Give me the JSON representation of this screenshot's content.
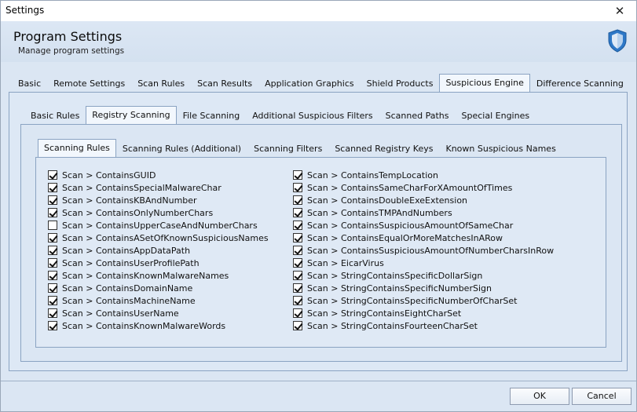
{
  "window": {
    "title": "Settings",
    "close_glyph": "✕"
  },
  "header": {
    "title": "Program Settings",
    "subtitle": "Manage program settings",
    "icon": "shield-icon"
  },
  "main_tabs": [
    {
      "label": "Basic",
      "active": false
    },
    {
      "label": "Remote Settings",
      "active": false
    },
    {
      "label": "Scan Rules",
      "active": false
    },
    {
      "label": "Scan Results",
      "active": false
    },
    {
      "label": "Application Graphics",
      "active": false
    },
    {
      "label": "Shield Products",
      "active": false
    },
    {
      "label": "Suspicious Engine",
      "active": true
    },
    {
      "label": "Difference Scanning",
      "active": false
    }
  ],
  "sub_tabs": [
    {
      "label": "Basic Rules",
      "active": false
    },
    {
      "label": "Registry Scanning",
      "active": true
    },
    {
      "label": "File Scanning",
      "active": false
    },
    {
      "label": "Additional Suspicious Filters",
      "active": false
    },
    {
      "label": "Scanned Paths",
      "active": false
    },
    {
      "label": "Special Engines",
      "active": false
    }
  ],
  "inner_tabs": [
    {
      "label": "Scanning Rules",
      "active": true
    },
    {
      "label": "Scanning Rules (Additional)",
      "active": false
    },
    {
      "label": "Scanning Filters",
      "active": false
    },
    {
      "label": "Scanned Registry Keys",
      "active": false
    },
    {
      "label": "Known Suspicious Names",
      "active": false
    }
  ],
  "rules_left": [
    {
      "label": "Scan > ContainsGUID",
      "checked": true
    },
    {
      "label": "Scan > ContainsSpecialMalwareChar",
      "checked": true
    },
    {
      "label": "Scan > ContainsKBAndNumber",
      "checked": true
    },
    {
      "label": "Scan > ContainsOnlyNumberChars",
      "checked": true
    },
    {
      "label": "Scan > ContainsUpperCaseAndNumberChars",
      "checked": false
    },
    {
      "label": "Scan > ContainsASetOfKnownSuspiciousNames",
      "checked": true
    },
    {
      "label": "Scan > ContainsAppDataPath",
      "checked": true
    },
    {
      "label": "Scan > ContainsUserProfilePath",
      "checked": true
    },
    {
      "label": "Scan > ContainsKnownMalwareNames",
      "checked": true
    },
    {
      "label": "Scan > ContainsDomainName",
      "checked": true
    },
    {
      "label": "Scan > ContainsMachineName",
      "checked": true
    },
    {
      "label": "Scan > ContainsUserName",
      "checked": true
    },
    {
      "label": "Scan > ContainsKnownMalwareWords",
      "checked": true
    }
  ],
  "rules_right": [
    {
      "label": "Scan > ContainsTempLocation",
      "checked": true
    },
    {
      "label": "Scan > ContainsSameCharForXAmountOfTimes",
      "checked": true
    },
    {
      "label": "Scan > ContainsDoubleExeExtension",
      "checked": true
    },
    {
      "label": "Scan > ContainsTMPAndNumbers",
      "checked": true
    },
    {
      "label": "Scan > ContainsSuspiciousAmountOfSameChar",
      "checked": true
    },
    {
      "label": "Scan > ContainsEqualOrMoreMatchesInARow",
      "checked": true
    },
    {
      "label": "Scan > ContainsSuspiciousAmountOfNumberCharsInRow",
      "checked": true
    },
    {
      "label": "Scan > EicarVirus",
      "checked": true
    },
    {
      "label": "Scan > StringContainsSpecificDollarSign",
      "checked": true
    },
    {
      "label": "Scan > StringContainsSpecificNumberSign",
      "checked": true
    },
    {
      "label": "Scan > StringContainsSpecificNumberOfCharSet",
      "checked": true
    },
    {
      "label": "Scan > StringContainsEightCharSet",
      "checked": true
    },
    {
      "label": "Scan > StringContainsFourteenCharSet",
      "checked": true
    }
  ],
  "footer": {
    "ok_label": "OK",
    "cancel_label": "Cancel"
  },
  "colors": {
    "panel_bg": "#dbe6f3",
    "tab_border": "#8aa3c2",
    "shield_blue": "#2e78c7"
  }
}
